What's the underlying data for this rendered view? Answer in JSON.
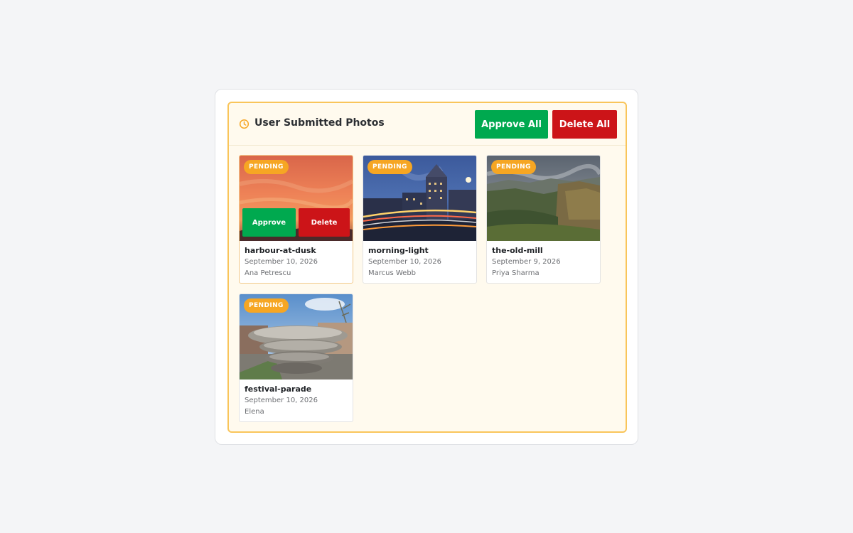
{
  "panel": {
    "title": "User Submitted Photos",
    "title_icon": "clock-icon",
    "approve_all_label": "Approve All",
    "delete_all_label": "Delete All"
  },
  "colors": {
    "approve": "#00a94f",
    "delete": "#cc1418",
    "pending": "#f6a623",
    "panel_border": "#f9c55a"
  },
  "photos": [
    {
      "name": "harbour-at-dusk",
      "date": "September 10, 2026",
      "author": "Ana Petrescu",
      "status": "PENDING",
      "approve_label": "Approve",
      "delete_label": "Delete"
    },
    {
      "name": "morning-light",
      "date": "September 10, 2026",
      "author": "Marcus Webb",
      "status": "PENDING"
    },
    {
      "name": "the-old-mill",
      "date": "September 9, 2026",
      "author": "Priya Sharma",
      "status": "PENDING"
    },
    {
      "name": "festival-parade",
      "date": "September 10, 2026",
      "author": "Elena",
      "status": "PENDING"
    }
  ]
}
